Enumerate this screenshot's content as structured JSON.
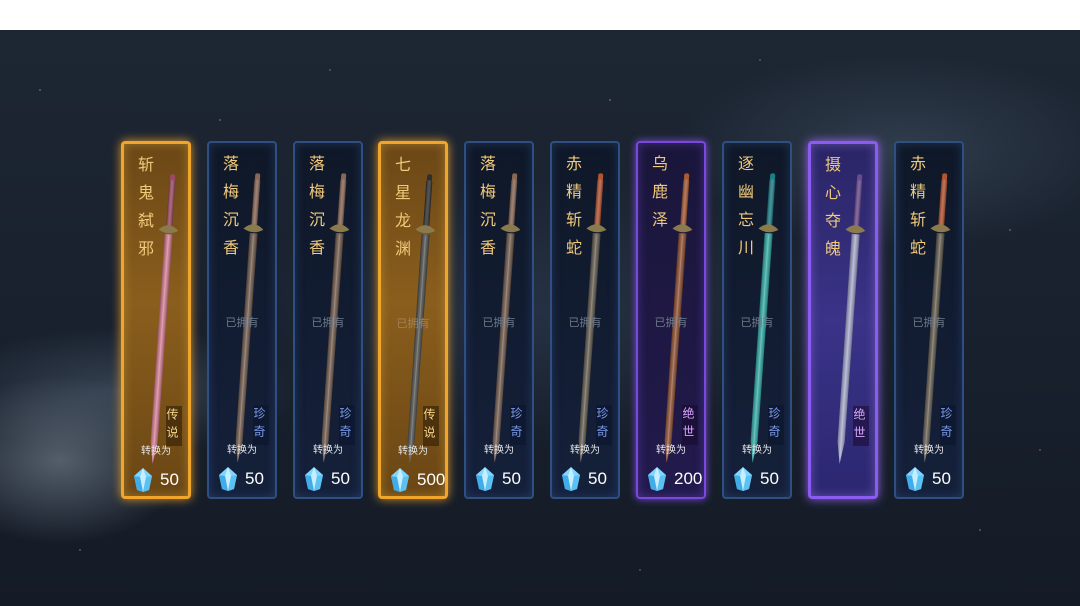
{
  "owned_text": "已拥有",
  "convert_text": "转换为",
  "currency_icon": "blue-crystal-icon",
  "colors": {
    "legend_border": "#f0a62a",
    "rare_border": "#2e4f82",
    "peerless_border": "#7a47e0",
    "name_text": "#f0c97a"
  },
  "cards": [
    {
      "name": "斩鬼弑邪",
      "rarity": "传说",
      "frame": "legend",
      "owned_label": "",
      "cost": "50",
      "blade": "#d1768c",
      "hilt": "#9b4a62"
    },
    {
      "name": "落梅沉香",
      "rarity": "珍奇",
      "frame": "rare",
      "owned_label": "已拥有",
      "cost": "50",
      "blade": "#6b5446",
      "hilt": "#8a6654"
    },
    {
      "name": "落梅沉香",
      "rarity": "珍奇",
      "frame": "rare",
      "owned_label": "已拥有",
      "cost": "50",
      "blade": "#6b5446",
      "hilt": "#8a6654"
    },
    {
      "name": "七星龙渊",
      "rarity": "传说",
      "frame": "legend",
      "owned_label": "已拥有",
      "cost": "500",
      "blade": "#4a4a48",
      "hilt": "#2e2e2e"
    },
    {
      "name": "落梅沉香",
      "rarity": "珍奇",
      "frame": "rare",
      "owned_label": "已拥有",
      "cost": "50",
      "blade": "#6b5446",
      "hilt": "#8a6654"
    },
    {
      "name": "赤精斩蛇",
      "rarity": "珍奇",
      "frame": "rare",
      "owned_label": "已拥有",
      "cost": "50",
      "blade": "#5e574a",
      "hilt": "#b4532f"
    },
    {
      "name": "乌鹿泽",
      "rarity": "绝世",
      "frame": "peerless",
      "owned_label": "已拥有",
      "cost": "200",
      "blade": "#8a4a2a",
      "hilt": "#a85a34"
    },
    {
      "name": "逐幽忘川",
      "rarity": "珍奇",
      "frame": "rare",
      "owned_label": "已拥有",
      "cost": "50",
      "blade": "#2aa6a0",
      "hilt": "#1c7e86"
    },
    {
      "name": "摄心夺魄",
      "rarity": "绝世",
      "frame": "lavender",
      "owned_label": "",
      "cost": "",
      "blade": "#9fa2c8",
      "hilt": "#6b4a8e"
    },
    {
      "name": "赤精斩蛇",
      "rarity": "珍奇",
      "frame": "rare",
      "owned_label": "已拥有",
      "cost": "50",
      "blade": "#5e574a",
      "hilt": "#b4532f"
    }
  ]
}
